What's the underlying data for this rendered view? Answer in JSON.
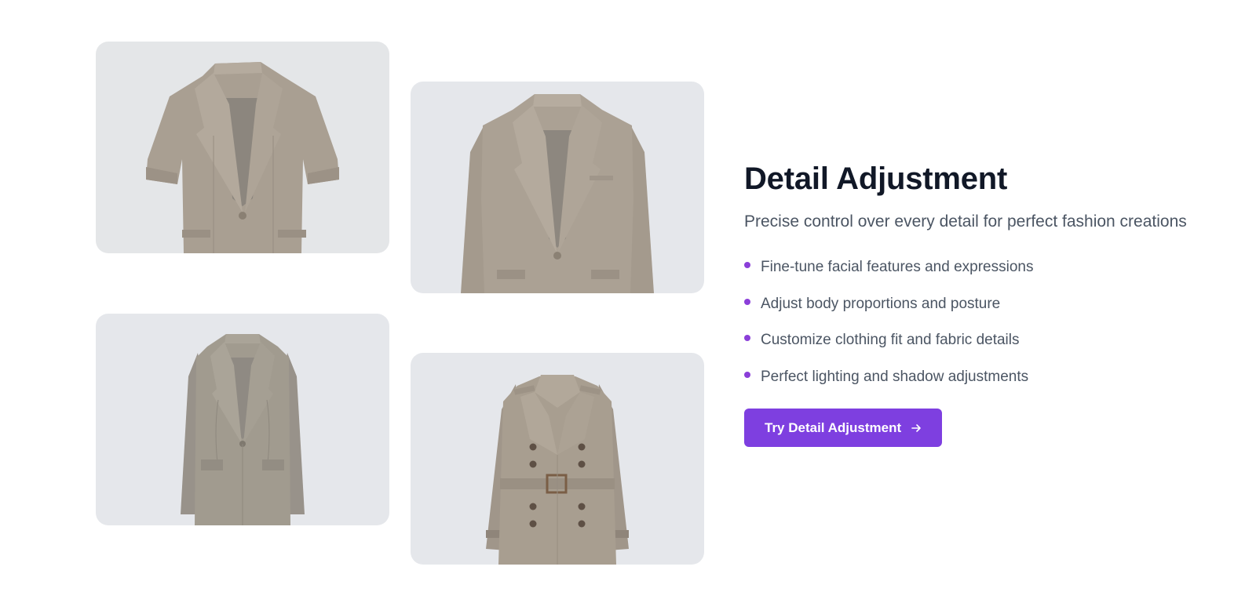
{
  "gallery": {
    "images": [
      {
        "name": "short-sleeve-blazer",
        "color": "#a89e91"
      },
      {
        "name": "long-sleeve-blazer",
        "color": "#aaa094"
      },
      {
        "name": "long-tweed-coat",
        "color": "#9f998d"
      },
      {
        "name": "trench-coat",
        "color": "#a79d8f"
      }
    ]
  },
  "section": {
    "title": "Detail Adjustment",
    "subtitle": "Precise control over every detail for perfect fashion creations",
    "features": [
      "Fine-tune facial features and expressions",
      "Adjust body proportions and posture",
      "Customize clothing fit and fabric details",
      "Perfect lighting and shadow adjustments"
    ],
    "cta_label": "Try Detail Adjustment"
  },
  "colors": {
    "accent": "#7e3fe0",
    "bullet": "#8b3fd9",
    "heading": "#111827",
    "body_text": "#4b5563",
    "card_bg": "#e5e7eb"
  },
  "icons": {
    "cta_icon": "arrow-right-icon",
    "bullet_icon": "dot-icon"
  }
}
